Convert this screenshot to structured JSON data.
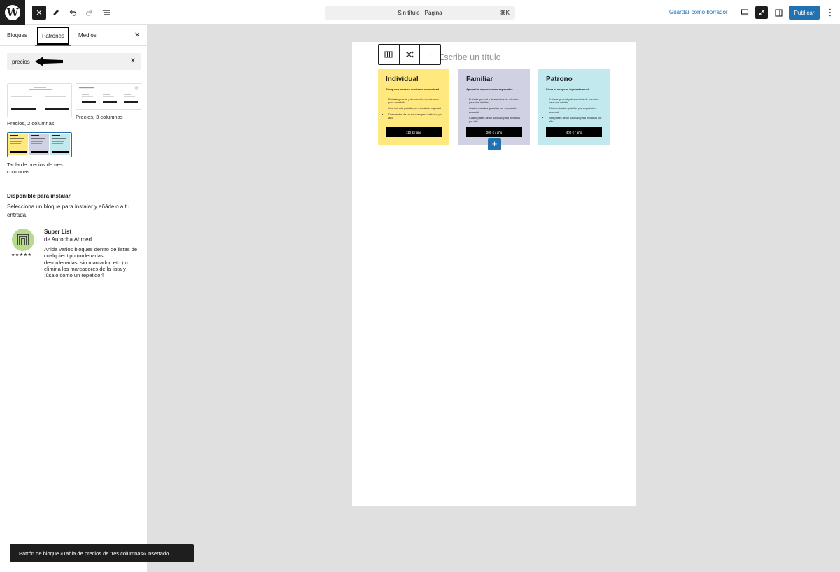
{
  "topbar": {
    "wp_logo": "W",
    "doc_title": "Sin título · Página",
    "shortcut": "⌘K",
    "save_draft": "Guardar como borrador",
    "publish": "Publicar"
  },
  "sidebar": {
    "tabs": [
      "Bloques",
      "Patrones",
      "Medios"
    ],
    "active_tab": "Patrones",
    "search_value": "precios",
    "patterns": [
      {
        "label": "Precios, 2 columnas"
      },
      {
        "label": "Precios, 3 columnas"
      },
      {
        "label": "Tabla de precios de tres columnas"
      }
    ],
    "install": {
      "title": "Disponible para instalar",
      "description": "Selecciona un bloque para instalar y añádelo a tu entrada.",
      "plugin": {
        "name": "Super List",
        "author": "de Aurooba Ahmed",
        "rating": 5,
        "stars": "★★★★★",
        "description": "Anida varios bloques dentro de listas de cualquier tipo (ordenadas, desordenadas, sin marcador, etc.) o elimina los marcadores de la lista y ¡úsalo como un repetidor!"
      }
    }
  },
  "snackbar": "Patrón de bloque «Tabla de precios de tres columnas» insertado.",
  "editor": {
    "title_placeholder": "Escribe un título",
    "columns": [
      {
        "name": "Individual",
        "subtitle": "Enriquece nuestra creciente comunidad.",
        "color": "#ffe97f",
        "features": [
          "Entrada general y descuentos de miembro para un adulto",
          "Una entrada gratuita por exposición especial",
          "Descuentos de un solo uso para invitados por año"
        ],
        "price": "110 € / año"
      },
      {
        "name": "Familiar",
        "subtitle": "Apoya las exposiciones especiales.",
        "color": "#d1d1e4",
        "features": [
          "Entrada general y descuentos de miembro para dos adultos",
          "Cuatro entradas gratuitas por exposición especial",
          "Cuatro pases de un solo uso para invitados por año"
        ],
        "price": "200 € / año"
      },
      {
        "name": "Patrono",
        "subtitle": "Lleva el apoyo al siguiente nivel.",
        "color": "#c2eaee",
        "features": [
          "Entrada general y descuentos de miembro para dos adultos",
          "Cinco entradas gratuitas por exposición especial",
          "Seis pases de un solo uso para invitados por año"
        ],
        "price": "400 € / año"
      }
    ]
  },
  "colors": {
    "accent": "#2271b1",
    "dark": "#1e1e1e"
  }
}
